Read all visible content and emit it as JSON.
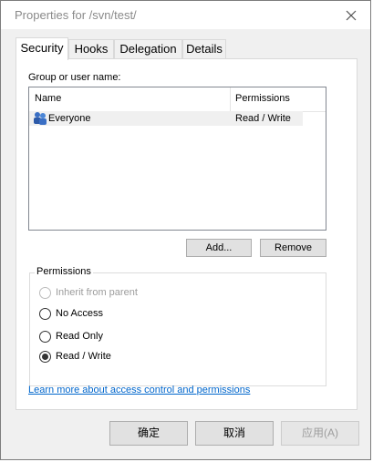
{
  "window": {
    "title": "Properties for /svn/test/"
  },
  "tabs": [
    {
      "label": "Security",
      "active": true
    },
    {
      "label": "Hooks",
      "active": false
    },
    {
      "label": "Delegation",
      "active": false
    },
    {
      "label": "Details",
      "active": false
    }
  ],
  "security": {
    "group_label": "Group or user name:",
    "columns": {
      "name": "Name",
      "permissions": "Permissions"
    },
    "rows": [
      {
        "name": "Everyone",
        "permissions": "Read / Write",
        "icon": "users-group-icon"
      }
    ],
    "add_button": "Add...",
    "remove_button": "Remove",
    "permissions_group_title": "Permissions",
    "options": [
      {
        "label": "Inherit from parent",
        "checked": false,
        "enabled": false
      },
      {
        "label": "No Access",
        "checked": false,
        "enabled": true
      },
      {
        "label": "Read Only",
        "checked": false,
        "enabled": true
      },
      {
        "label": "Read / Write",
        "checked": true,
        "enabled": true
      }
    ],
    "learn_more_link": "Learn more about access control and permissions"
  },
  "footer": {
    "ok": "确定",
    "cancel": "取消",
    "apply": "应用(A)"
  },
  "colors": {
    "link": "#0066cc",
    "disabled_text": "#9c9c9c"
  }
}
